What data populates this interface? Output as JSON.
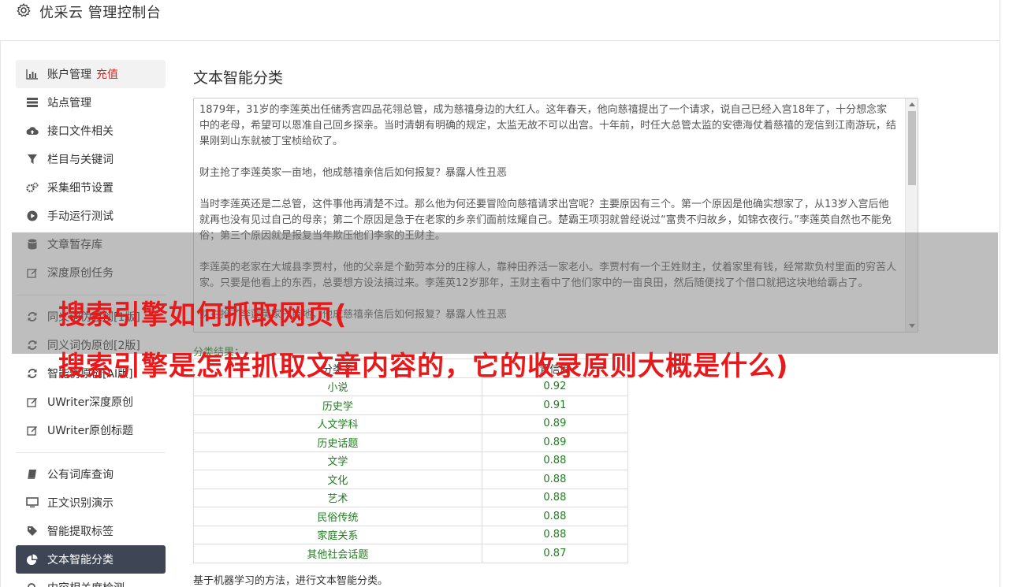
{
  "header": {
    "title": "优采云 管理控制台",
    "icon": "gear-icon"
  },
  "sidebar": {
    "items": [
      {
        "label": "账户管理",
        "badge": "充值",
        "icon": "bar-chart-icon",
        "state": "hover"
      },
      {
        "label": "站点管理",
        "icon": "server-icon"
      },
      {
        "label": "接口文件相关",
        "icon": "cloud-upload-icon"
      },
      {
        "label": "栏目与关键词",
        "icon": "filter-icon"
      },
      {
        "label": "采集细节设置",
        "icon": "gears-icon"
      },
      {
        "label": "手动运行测试",
        "icon": "play-circle-icon"
      },
      {
        "label": "文章暂存库",
        "icon": "database-icon"
      },
      {
        "label": "深度原创任务",
        "icon": "edit-icon"
      },
      {
        "label": "同义词伪原创[1版]",
        "icon": "refresh-icon"
      },
      {
        "label": "同义词伪原创[2版]",
        "icon": "refresh-icon"
      },
      {
        "label": "智能伪原创[AI版]",
        "icon": "refresh-icon"
      },
      {
        "label": "UWriter深度原创",
        "icon": "edit-icon"
      },
      {
        "label": "UWriter原创标题",
        "icon": "edit-icon"
      },
      {
        "label": "公有词库查询",
        "icon": "book-icon"
      },
      {
        "label": "正文识别演示",
        "icon": "monitor-icon"
      },
      {
        "label": "智能提取标签",
        "icon": "tag-icon"
      },
      {
        "label": "文本智能分类",
        "icon": "pie-chart-icon",
        "state": "active"
      },
      {
        "label": "内容相关度检测",
        "icon": "search-icon"
      }
    ]
  },
  "main": {
    "title": "文本智能分类",
    "text_paragraphs": [
      "1879年，31岁的李莲英出任储秀宫四品花翎总管，成为慈禧身边的大红人。这年春天，他向慈禧提出了一个请求，说自己已经入宫18年了，十分想念家中的老母，希望可以恩准自己回乡探亲。当时清朝有明确的规定，太监无故不可以出宫。十年前，时任大总管太监的安德海仗着慈禧的宠信到江南游玩，结果刚到山东就被丁宝桢给砍了。",
      "财主抢了李莲英家一亩地，他成慈禧亲信后如何报复？暴露人性丑恶",
      "当时李莲英还是二总管，这件事他再清楚不过。那么他为何还要冒险向慈禧请求出宫呢？主要原因有三个。第一个原因是他确实想家了，从13岁入宫后他就再也没有见过自己的母亲；第二个原因是急于在老家的乡亲们面前炫耀自己。楚霸王项羽就曾经说过“富贵不归故乡，如锦衣夜行。”李莲英自然也不能免俗；第三个原因就是报复当年欺压他们李家的王财主。",
      "李莲英的老家在大城县李贾村，他的父亲是个勤劳本分的庄稼人，靠种田养活一家老小。李贾村有一个王姓财主，仗着家里有钱，经常欺负村里面的穷苦人家。只要是他看上的东西，总要想方设法搞过来。李莲英12岁那年，王财主看中了他们家中的一亩良田，然后随便找了个借口就把这块地给霸占了。",
      "财主抢了李莲英家一亩地，他成慈禧亲信后如何报复？暴露人性丑恶"
    ],
    "result_label": "分类结果：",
    "table": {
      "headers": [
        "分类名",
        "置信度"
      ],
      "rows": [
        [
          "小说",
          "0.92"
        ],
        [
          "历史学",
          "0.91"
        ],
        [
          "人文学科",
          "0.89"
        ],
        [
          "历史话题",
          "0.89"
        ],
        [
          "文学",
          "0.88"
        ],
        [
          "文化",
          "0.88"
        ],
        [
          "艺术",
          "0.88"
        ],
        [
          "民俗传统",
          "0.88"
        ],
        [
          "家庭关系",
          "0.88"
        ],
        [
          "其他社会话题",
          "0.87"
        ]
      ]
    },
    "footer_note": "基于机器学习的方法，进行文本智能分类。"
  },
  "overlay": {
    "line1": "搜索引擎如何抓取网页(",
    "line2": "搜索引擎是怎样抓取文章内容的，它的收录原则大概是什么)"
  },
  "colors": {
    "active_nav": "#3e4656",
    "recharge": "#e02020",
    "result_green": "#1e7e1e",
    "overlay_text": "#e8191b"
  }
}
